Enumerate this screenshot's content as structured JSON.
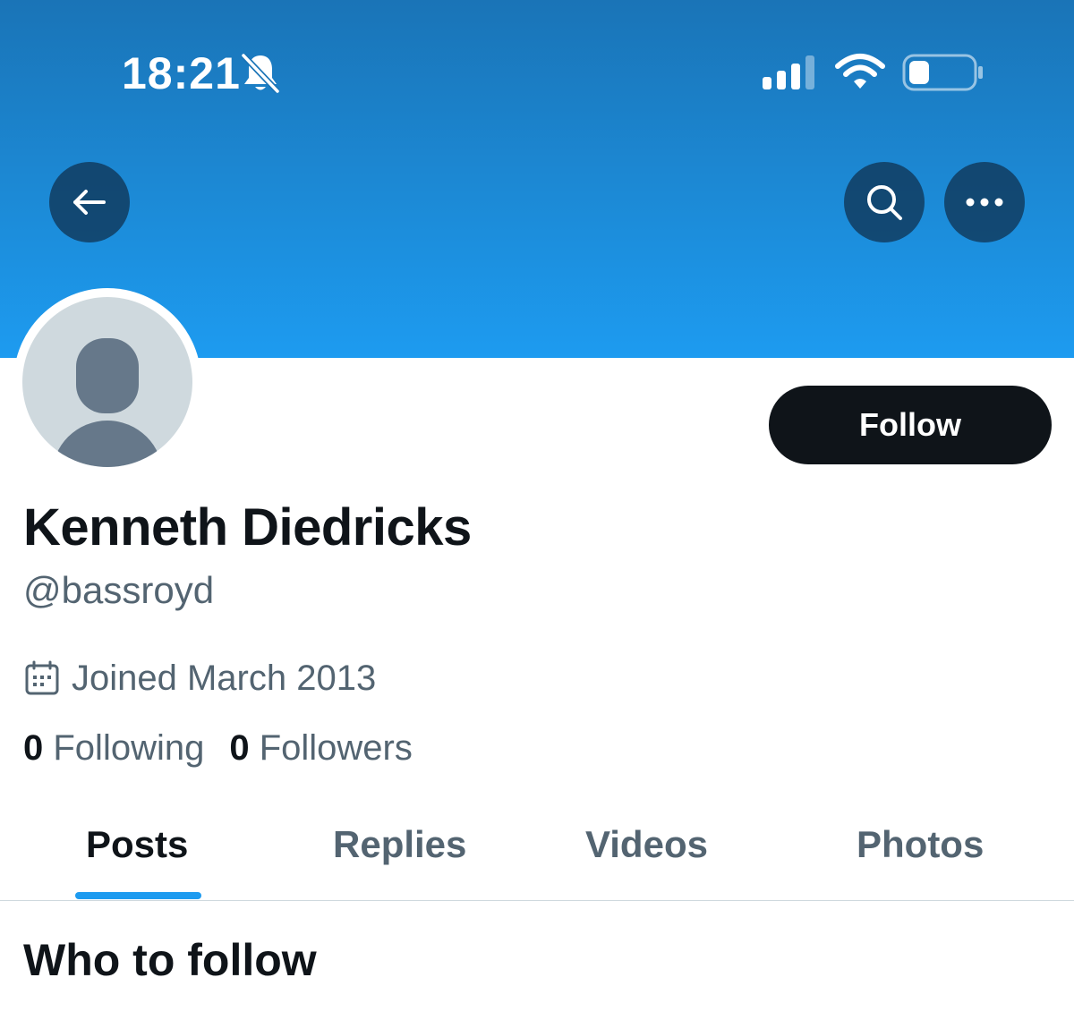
{
  "status_bar": {
    "time": "18:21",
    "icons": [
      "bell-slash-icon",
      "cellular-signal-icon",
      "wifi-icon",
      "battery-icon"
    ]
  },
  "header": {
    "back_icon": "arrow-left-icon",
    "search_icon": "search-icon",
    "more_icon": "more-horizontal-icon"
  },
  "profile": {
    "display_name": "Kenneth Diedricks",
    "handle": "@bassroyd",
    "joined": "Joined March 2013",
    "following_count": "0",
    "following_label": "Following",
    "followers_count": "0",
    "followers_label": "Followers",
    "follow_button_label": "Follow"
  },
  "tabs": [
    {
      "label": "Posts",
      "active": true
    },
    {
      "label": "Replies",
      "active": false
    },
    {
      "label": "Videos",
      "active": false
    },
    {
      "label": "Photos",
      "active": false
    }
  ],
  "section": {
    "title": "Who to follow"
  },
  "colors": {
    "banner_top": "#1a74b7",
    "banner_bottom": "#1d9bf0",
    "accent": "#1d9bf0",
    "text_primary": "#0f1419",
    "text_secondary": "#536471"
  }
}
